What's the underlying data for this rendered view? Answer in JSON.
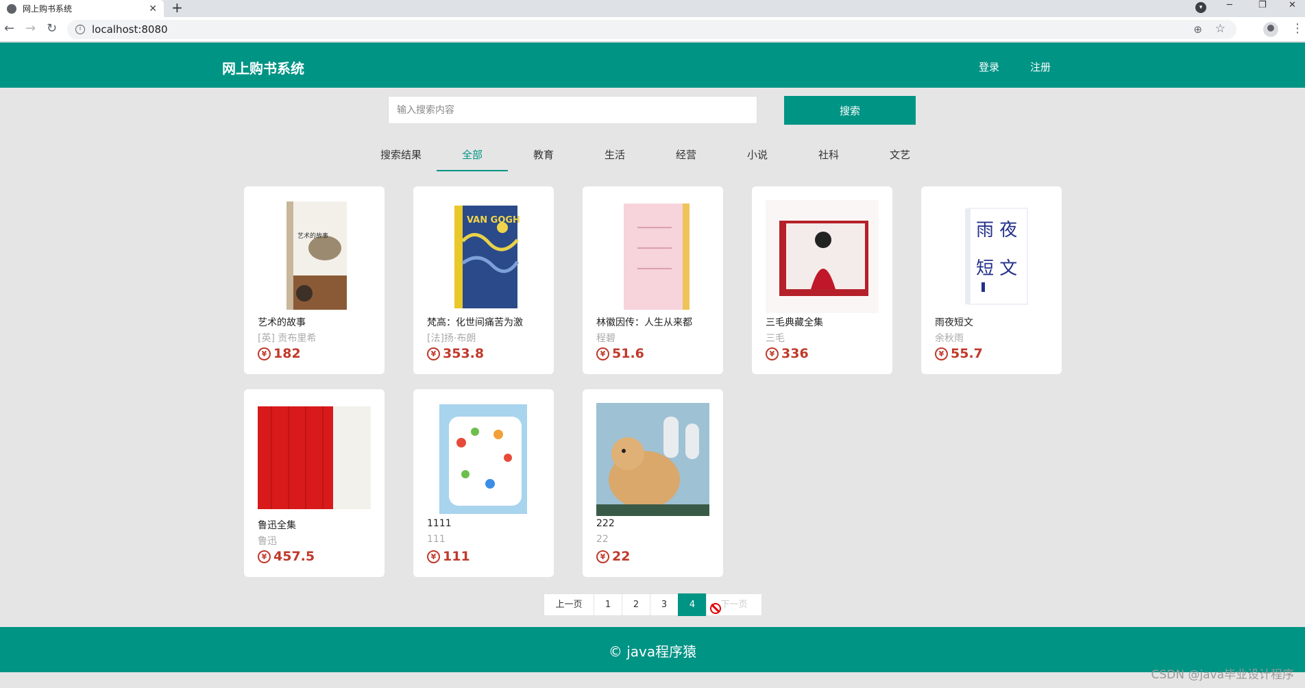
{
  "browser": {
    "tab_title": "网上购书系统",
    "tab_close": "✕",
    "new_tab": "+",
    "url": "localhost:8080"
  },
  "header": {
    "brand": "网上购书系统",
    "login": "登录",
    "register": "注册"
  },
  "search": {
    "placeholder": "输入搜索内容",
    "button": "搜索"
  },
  "categories": [
    {
      "label": "搜索结果"
    },
    {
      "label": "全部"
    },
    {
      "label": "教育"
    },
    {
      "label": "生活"
    },
    {
      "label": "经营"
    },
    {
      "label": "小说"
    },
    {
      "label": "社科"
    },
    {
      "label": "文艺"
    }
  ],
  "active_category": "全部",
  "books": [
    {
      "title": "艺术的故事",
      "author": "[英] 贡布里希",
      "price": "182"
    },
    {
      "title": "梵高：化世间痛苦为激",
      "author": "[法]扬·布朗",
      "price": "353.8"
    },
    {
      "title": "林徽因传：人生从来都",
      "author": "程碧",
      "price": "51.6"
    },
    {
      "title": "三毛典藏全集",
      "author": "三毛",
      "price": "336"
    },
    {
      "title": "雨夜短文",
      "author": "余秋雨",
      "price": "55.7"
    },
    {
      "title": "鲁迅全集",
      "author": "鲁迅",
      "price": "457.5"
    },
    {
      "title": "1111",
      "author": "111",
      "price": "111"
    },
    {
      "title": "222",
      "author": "22",
      "price": "22"
    }
  ],
  "currency_symbol": "¥",
  "pagination": {
    "prev": "上一页",
    "pages": [
      "1",
      "2",
      "3",
      "4"
    ],
    "current": "4",
    "next": "下一页"
  },
  "footer": {
    "copyright": "© java程序猿"
  },
  "watermark": "CSDN @java毕业设计程序",
  "colors": {
    "primary": "#009485",
    "price": "#c0392b",
    "background": "#e5e5e5"
  }
}
